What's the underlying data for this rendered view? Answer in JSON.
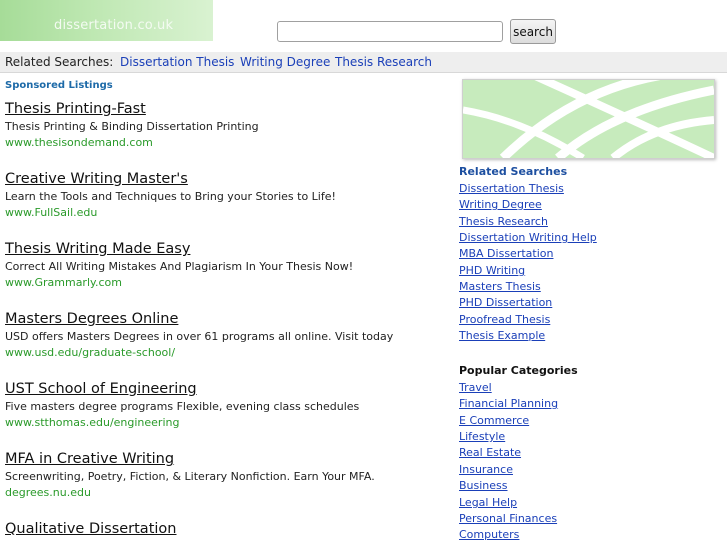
{
  "header": {
    "logo_text": "dissertation.co.uk",
    "search_value": "",
    "search_button": "search"
  },
  "related_bar": {
    "label": "Related Searches:",
    "links": [
      "Dissertation Thesis",
      "Writing Degree",
      "Thesis Research"
    ]
  },
  "sponsored_label": "Sponsored Listings",
  "listings": [
    {
      "title": "Thesis Printing-Fast",
      "desc": "Thesis Printing & Binding Dissertation Printing",
      "url": "www.thesisondemand.com"
    },
    {
      "title": "Creative Writing Master's",
      "desc": "Learn the Tools and Techniques to Bring your Stories to Life!",
      "url": "www.FullSail.edu"
    },
    {
      "title": "Thesis Writing Made Easy",
      "desc": "Correct All Writing Mistakes And Plagiarism In Your Thesis Now!",
      "url": "www.Grammarly.com"
    },
    {
      "title": "Masters Degrees Online",
      "desc": "USD offers Masters Degrees in over 61 programs all online. Visit today",
      "url": "www.usd.edu/graduate-school/"
    },
    {
      "title": "UST School of Engineering",
      "desc": "Five masters degree programs Flexible, evening class schedules",
      "url": "www.stthomas.edu/engineering"
    },
    {
      "title": "MFA in Creative Writing",
      "desc": "Screenwriting, Poetry, Fiction, & Literary Nonfiction. Earn Your MFA.",
      "url": "degrees.nu.edu"
    },
    {
      "title": "Qualitative Dissertation",
      "desc": "",
      "url": ""
    }
  ],
  "sidebar": {
    "related_heading": "Related Searches",
    "related_links": [
      "Dissertation Thesis",
      "Writing Degree",
      "Thesis Research",
      "Dissertation Writing Help",
      "MBA Dissertation",
      "PHD Writing",
      "Masters Thesis",
      "PHD Dissertation",
      "Proofread Thesis",
      "Thesis Example"
    ],
    "popular_heading": "Popular Categories",
    "popular_links": [
      "Travel",
      "Financial Planning",
      "E Commerce",
      "Lifestyle",
      "Real Estate",
      "Insurance",
      "Business",
      "Legal Help",
      "Personal Finances",
      "Computers"
    ]
  }
}
